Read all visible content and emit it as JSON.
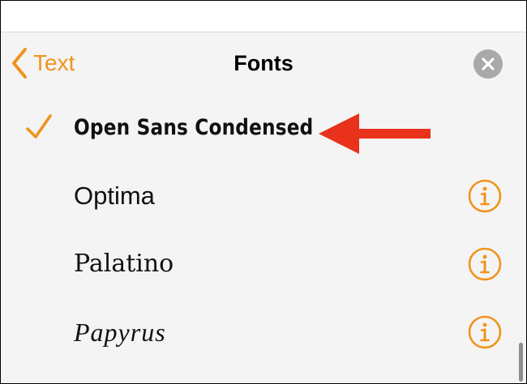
{
  "header": {
    "back_label": "Text",
    "title": "Fonts"
  },
  "fonts": [
    {
      "label": "Open Sans Condensed",
      "selected": true,
      "info": false
    },
    {
      "label": "Optima",
      "selected": false,
      "info": true
    },
    {
      "label": "Palatino",
      "selected": false,
      "info": true
    },
    {
      "label": "Papyrus",
      "selected": false,
      "info": true
    }
  ],
  "icons": {
    "back": "chevron-left-icon",
    "close": "close-icon",
    "check": "checkmark-icon",
    "info": "info-icon",
    "annotation": "red-arrow-left"
  },
  "colors": {
    "accent": "#f0941e",
    "panel_bg": "#f4f4f4",
    "close_bg": "#a9a9a9",
    "annotation_arrow": "#e8321c"
  }
}
